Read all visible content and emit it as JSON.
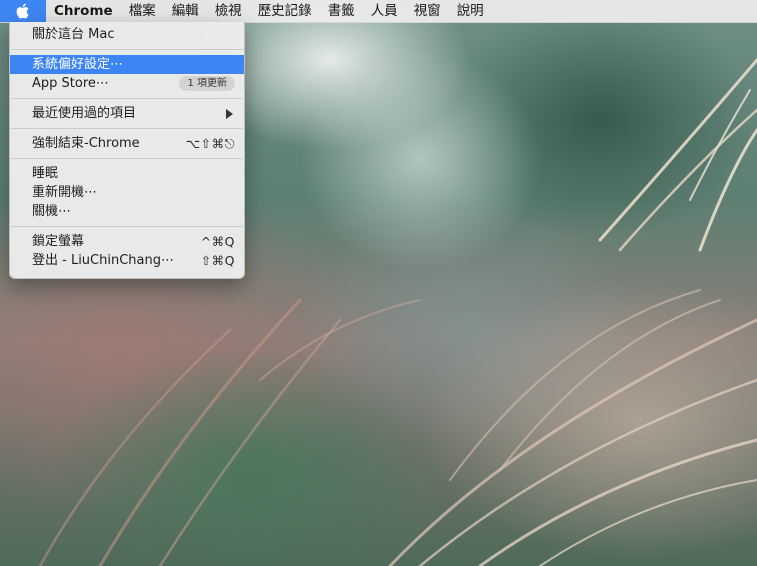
{
  "menubar": {
    "apple_icon": "apple-icon",
    "app_name": "Chrome",
    "items": [
      "檔案",
      "編輯",
      "檢視",
      "歷史記錄",
      "書籤",
      "人員",
      "視窗",
      "說明"
    ]
  },
  "apple_menu": {
    "about": "關於這台 Mac",
    "system_prefs": "系統偏好設定⋯",
    "app_store": "App Store⋯",
    "app_store_badge": "1 項更新",
    "recent_items": "最近使用過的項目",
    "force_quit": "強制結束-Chrome",
    "force_quit_shortcut": "⌥⇧⌘⎋",
    "sleep": "睡眠",
    "restart": "重新開機⋯",
    "shutdown": "關機⋯",
    "lock_screen": "鎖定螢幕",
    "lock_screen_shortcut": "^⌘Q",
    "logout": "登出 - LiuChinChang⋯",
    "logout_shortcut": "⇧⌘Q"
  },
  "colors": {
    "highlight": "#3d85f5",
    "apple_active": "#3f86f5"
  }
}
